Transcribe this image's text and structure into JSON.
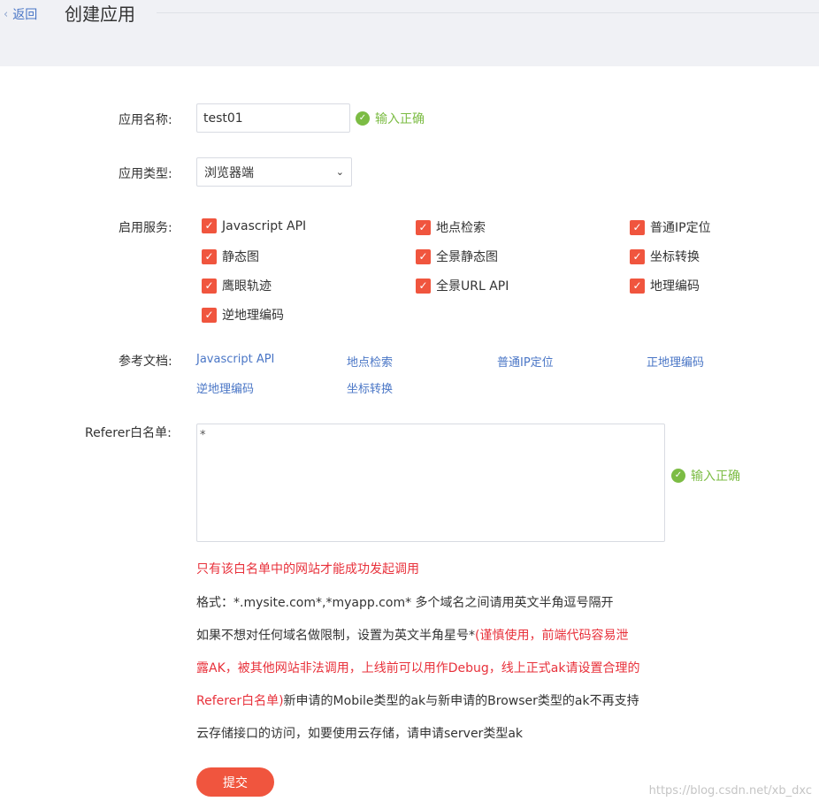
{
  "header": {
    "back_label": "返回",
    "title": "创建应用"
  },
  "form": {
    "app_name": {
      "label": "应用名称:",
      "value": "test01",
      "status": "输入正确"
    },
    "app_type": {
      "label": "应用类型:",
      "selected": "浏览器端"
    },
    "services": {
      "label": "启用服务:",
      "items": [
        {
          "label": "Javascript API",
          "checked": true
        },
        {
          "label": "地点检索",
          "checked": true
        },
        {
          "label": "普通IP定位",
          "checked": true
        },
        {
          "label": "静态图",
          "checked": true
        },
        {
          "label": "全景静态图",
          "checked": true
        },
        {
          "label": "坐标转换",
          "checked": true
        },
        {
          "label": "鹰眼轨迹",
          "checked": true
        },
        {
          "label": "全景URL API",
          "checked": true
        },
        {
          "label": "地理编码",
          "checked": true
        },
        {
          "label": "逆地理编码",
          "checked": true
        }
      ]
    },
    "docs": {
      "label": "参考文档:",
      "links": [
        "Javascript API",
        "地点检索",
        "普通IP定位",
        "正地理编码",
        "逆地理编码",
        "坐标转换"
      ]
    },
    "referer": {
      "label": "Referer白名单:",
      "value": "*",
      "status": "输入正确"
    },
    "notes": {
      "line1": "只有该白名单中的网站才能成功发起调用",
      "line2": "格式：*.mysite.com*,*myapp.com* 多个域名之间请用英文半角逗号隔开",
      "line3_normal": "如果不想对任何域名做限制，设置为英文半角星号*",
      "line3_red": "(谨慎使用，前端代码容易泄",
      "line4": "露AK，被其他网站非法调用，上线前可以用作Debug，线上正式ak请设置合理的",
      "line5_red": "Referer白名单)",
      "line5_normal": "新申请的Mobile类型的ak与新申请的Browser类型的ak不再支持",
      "line6": "云存储接口的访问，如要使用云存储，请申请server类型ak"
    },
    "submit_label": "提交"
  },
  "watermark": "https://blog.csdn.net/xb_dxc",
  "colors": {
    "accent_red": "#f0553e",
    "link_blue": "#4a76c6",
    "success_green": "#7cbc44",
    "warning_red": "#e8313b"
  },
  "icons": {
    "back": "chevron-left-icon",
    "status": "check-circle-icon",
    "select": "chevron-down-icon",
    "checkbox": "checkmark-icon"
  }
}
